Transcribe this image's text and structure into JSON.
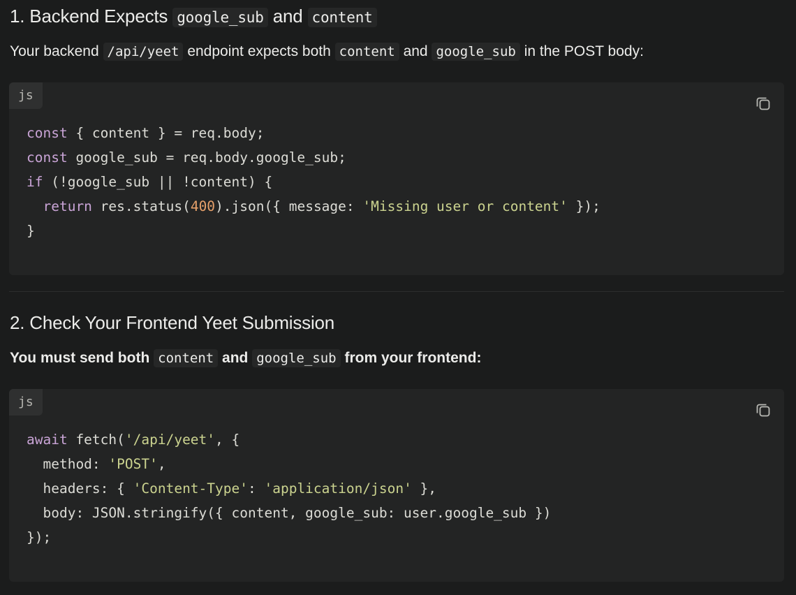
{
  "section1": {
    "heading_prefix": "1. Backend Expects",
    "heading_code1": "google_sub",
    "heading_and": "and",
    "heading_code2": "content",
    "para_text1": "Your backend",
    "para_code1": "/api/yeet",
    "para_text2": "endpoint expects both",
    "para_code2": "content",
    "para_text3": "and",
    "para_code3": "google_sub",
    "para_text4": "in the POST body:",
    "code_lang": "js",
    "code_lines": [
      [
        {
          "t": "const",
          "c": "kw"
        },
        {
          "t": " { content } = req.body;",
          "c": ""
        }
      ],
      [
        {
          "t": "const",
          "c": "kw"
        },
        {
          "t": " google_sub = req.body.google_sub;",
          "c": ""
        }
      ],
      [
        {
          "t": "if",
          "c": "kw"
        },
        {
          "t": " (!google_sub || !content) {",
          "c": ""
        }
      ],
      [
        {
          "t": "  ",
          "c": ""
        },
        {
          "t": "return",
          "c": "kw"
        },
        {
          "t": " res.status(",
          "c": ""
        },
        {
          "t": "400",
          "c": "num"
        },
        {
          "t": ").json({ message: ",
          "c": ""
        },
        {
          "t": "'Missing user or content'",
          "c": "str"
        },
        {
          "t": " });",
          "c": ""
        }
      ],
      [
        {
          "t": "}",
          "c": ""
        }
      ]
    ]
  },
  "section2": {
    "heading": "2. Check Your Frontend Yeet Submission",
    "para_text1": "You must send both",
    "para_code1": "content",
    "para_text2": "and",
    "para_code2": "google_sub",
    "para_text3": "from your frontend:",
    "code_lang": "js",
    "code_lines": [
      [
        {
          "t": "await",
          "c": "kw"
        },
        {
          "t": " fetch(",
          "c": ""
        },
        {
          "t": "'/api/yeet'",
          "c": "str"
        },
        {
          "t": ", {",
          "c": ""
        }
      ],
      [
        {
          "t": "  method: ",
          "c": ""
        },
        {
          "t": "'POST'",
          "c": "str"
        },
        {
          "t": ",",
          "c": ""
        }
      ],
      [
        {
          "t": "  headers: { ",
          "c": ""
        },
        {
          "t": "'Content-Type'",
          "c": "str"
        },
        {
          "t": ": ",
          "c": ""
        },
        {
          "t": "'application/json'",
          "c": "str"
        },
        {
          "t": " },",
          "c": ""
        }
      ],
      [
        {
          "t": "  body: JSON.stringify({ content, google_sub: user.google_sub })",
          "c": ""
        }
      ],
      [
        {
          "t": "});",
          "c": ""
        }
      ]
    ]
  },
  "icons": {
    "copy": "copy-icon"
  },
  "colors": {
    "background": "#1b1c1c",
    "code_bg": "#232424",
    "keyword": "#c9a4d6",
    "string": "#cbd38f",
    "number": "#e6a06a"
  }
}
